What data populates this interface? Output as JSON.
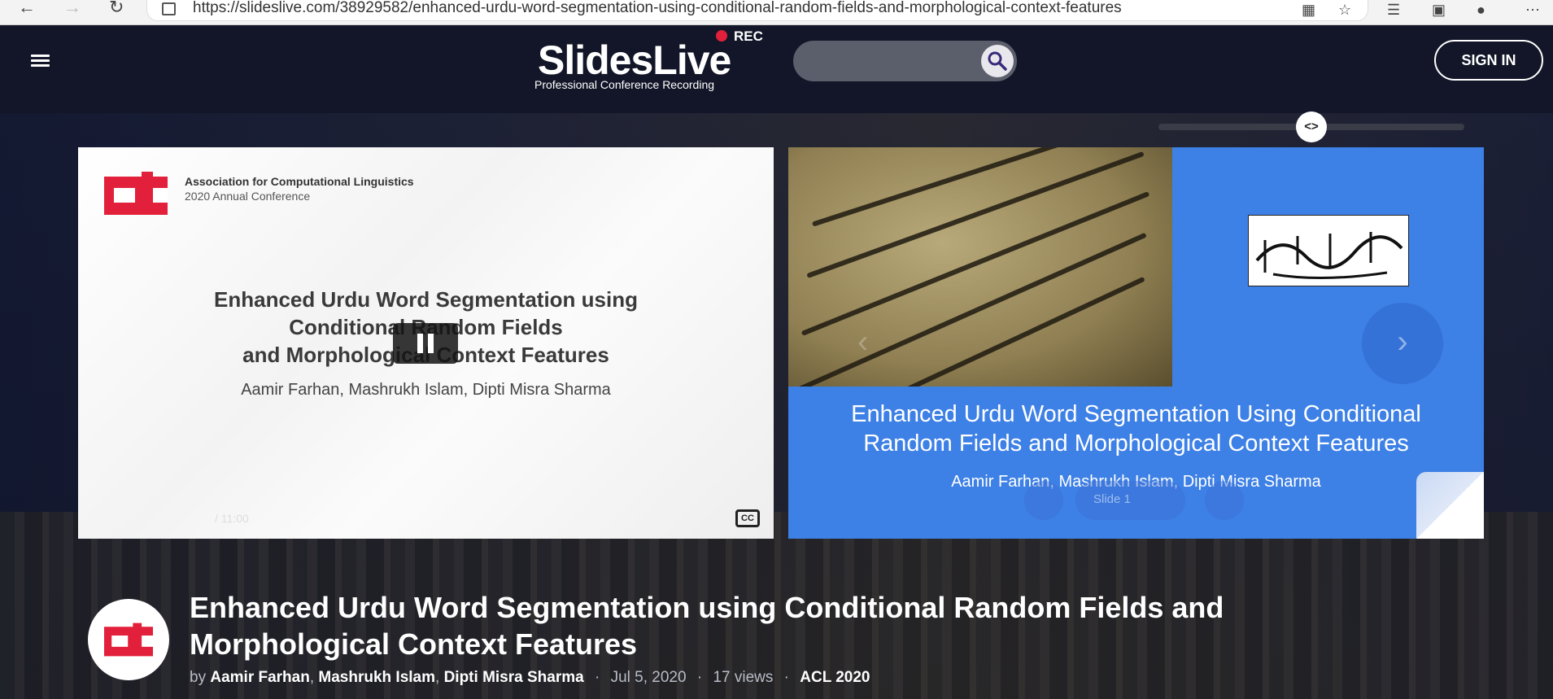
{
  "browser": {
    "url": "https://slideslive.com/38929582/enhanced-urdu-word-segmentation-using-conditional-random-fields-and-morphological-context-features"
  },
  "header": {
    "brand": "SlidesLive",
    "tagline": "Professional Conference Recording",
    "rec_label": "REC",
    "sign_in_label": "SIGN IN",
    "search_placeholder": ""
  },
  "video": {
    "org_name": "Association for Computational Linguistics",
    "org_sub": "2020 Annual Conference",
    "title_line1": "Enhanced Urdu Word Segmentation using",
    "title_line2": "Conditional Random Fields",
    "title_line3": "and Morphological Context Features",
    "authors": "Aamir Farhan, Mashrukh Islam, Dipti Misra Sharma",
    "time": "/ 11:00",
    "cc_label": "CC"
  },
  "slide": {
    "title": "Enhanced Urdu Word Segmentation Using Conditional Random Fields and Morphological Context Features",
    "authors": "Aamir Farhan, Mashrukh Islam, Dipti Misra Sharma",
    "slide_label": "Slide 1"
  },
  "talk": {
    "title": "Enhanced Urdu Word Segmentation using Conditional Random Fields and Morphological Context Features",
    "by": "by",
    "authors": [
      "Aamir Farhan",
      "Mashrukh Islam",
      "Dipti Misra Sharma"
    ],
    "date": "Jul 5, 2020",
    "views": "17 views",
    "event": "ACL 2020"
  },
  "colors": {
    "accent_red": "#e2203b",
    "slide_blue": "#3d80e6",
    "header_bg": "#121628"
  }
}
